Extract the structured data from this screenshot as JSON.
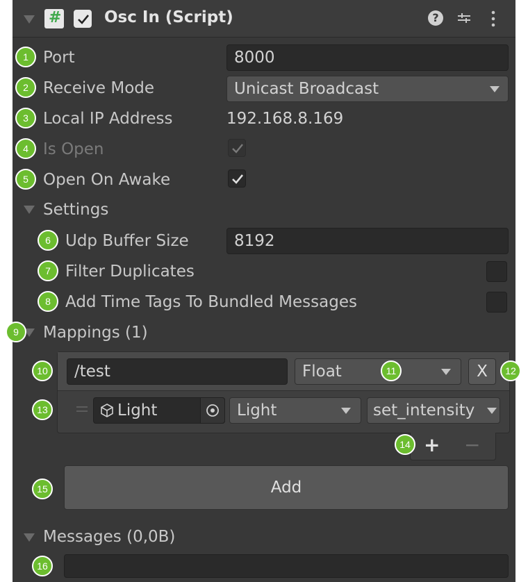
{
  "header": {
    "script_icon": "#",
    "title": "Osc In (Script)",
    "enabled": true
  },
  "fields": {
    "port": {
      "label": "Port",
      "value": "8000"
    },
    "receive_mode": {
      "label": "Receive Mode",
      "value": "Unicast Broadcast"
    },
    "local_ip": {
      "label": "Local IP Address",
      "value": "192.168.8.169"
    },
    "is_open": {
      "label": "Is Open",
      "checked": true
    },
    "open_on_awake": {
      "label": "Open On Awake",
      "checked": true
    }
  },
  "settings": {
    "label": "Settings",
    "udp_buffer": {
      "label": "Udp Buffer Size",
      "value": "8192"
    },
    "filter_duplicates": {
      "label": "Filter Duplicates",
      "checked": false
    },
    "add_time_tags": {
      "label": "Add Time Tags To Bundled Messages",
      "checked": false
    }
  },
  "mappings": {
    "label": "Mappings (1)",
    "address": "/test",
    "type": "Float",
    "remove_label": "X",
    "target_object": "Light",
    "component": "Light",
    "method": "set_intensity",
    "plus": "+",
    "minus": "−",
    "add_label": "Add"
  },
  "messages": {
    "label": "Messages (0,0B)",
    "value": ""
  },
  "badges": [
    "1",
    "2",
    "3",
    "4",
    "5",
    "6",
    "7",
    "8",
    "9",
    "10",
    "11",
    "12",
    "13",
    "14",
    "15",
    "16"
  ],
  "colors": {
    "badge": "#6cbd2f",
    "panel": "#383838",
    "field": "#2a2a2a",
    "script_icon": "#3fa94b"
  }
}
